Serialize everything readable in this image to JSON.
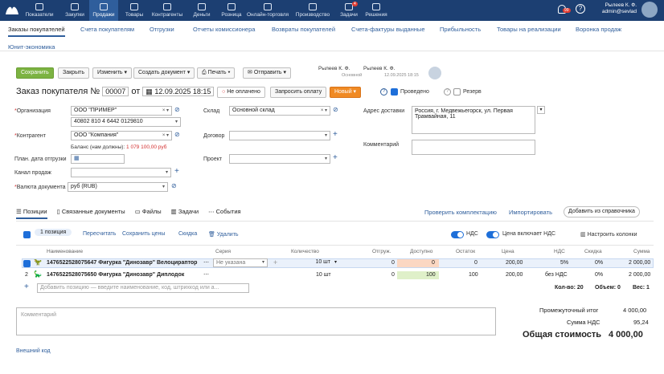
{
  "topnav": {
    "items": [
      {
        "label": "Показатели",
        "icon": "chart-icon"
      },
      {
        "label": "Закупки",
        "icon": "cart-icon"
      },
      {
        "label": "Продажи",
        "icon": "bag-icon"
      },
      {
        "label": "Товары",
        "icon": "box-icon"
      },
      {
        "label": "Контрагенты",
        "icon": "people-icon"
      },
      {
        "label": "Деньги",
        "icon": "money-icon"
      },
      {
        "label": "Розница",
        "icon": "store-icon"
      },
      {
        "label": "Онлайн-торговля",
        "icon": "globe-icon"
      },
      {
        "label": "Производство",
        "icon": "factory-icon"
      },
      {
        "label": "Задачи",
        "icon": "tasks-icon"
      },
      {
        "label": "Решения",
        "icon": "puzzle-icon"
      }
    ],
    "tasks_badge": "4",
    "bell_badge": "99",
    "user_name": "Рылеев К. Ф.",
    "user_account": "admin@sevlad"
  },
  "subtabs": [
    "Заказы покупателей",
    "Счета покупателям",
    "Отгрузки",
    "Отчеты комиссионера",
    "Возвраты покупателей",
    "Счета-фактуры выданные",
    "Прибыльность",
    "Товары на реализации",
    "Воронка продаж",
    "Юнит-экономика"
  ],
  "toolbar": {
    "save": "Сохранить",
    "close": "Закрыть",
    "edit": "Изменить",
    "create": "Создать документ",
    "print": "Печать",
    "send": "Отправить",
    "owner_name": "Рылеев К. Ф.",
    "owner_sub": "Основной",
    "author_name": "Рылеев К. Ф.",
    "author_date": "12.09.2025 18:15"
  },
  "header": {
    "title": "Заказ покупателя №",
    "number": "00007",
    "from": "от",
    "date": "12.09.2025 18:15",
    "payment": "Не оплачено",
    "request": "Запросить оплату",
    "status": "Новый",
    "posted": "Проведено",
    "reserve": "Резерв"
  },
  "form": {
    "org_label": "Организация",
    "org": "ООО \"ПРИМЕР\"",
    "account": "40802 810 4 6442 0129810",
    "contractor_label": "Контрагент",
    "contractor": "ООО \"Компания\"",
    "balance_label": "Баланс (нам должны):",
    "balance": "1 079 100,00 руб",
    "ship_date_label": "План. дата отгрузки",
    "channel_label": "Канал продаж",
    "currency_label": "Валюта документа",
    "currency": "руб (RUB)",
    "warehouse_label": "Склад",
    "warehouse": "Основной склад",
    "contract_label": "Договор",
    "project_label": "Проект",
    "address_label": "Адрес доставки",
    "address": "Россия, г. Медвежьегорск, ул. Первая Трамвайная, 11",
    "comment_label": "Комментарий"
  },
  "doc_tabs": [
    "Позиции",
    "Связанные документы",
    "Файлы",
    "Задачи",
    "События"
  ],
  "doc_actions": {
    "check": "Проверить комплектацию",
    "import": "Импортировать",
    "add": "Добавить из справочника"
  },
  "positions_bar": {
    "count": "1 позиция",
    "recalc": "Пересчитать",
    "save_prices": "Сохранить цены",
    "discount": "Скидка",
    "delete": "Удалить",
    "vat": "НДС",
    "price_incl_vat": "Цена включает НДС",
    "columns": "Настроить колонки"
  },
  "table": {
    "headers": [
      "Наименование",
      "Серия",
      "Количество",
      "Отгруж.",
      "Доступно",
      "Остаток",
      "Цена",
      "НДС",
      "Скидка",
      "Сумма"
    ],
    "rows": [
      {
        "num": "1",
        "name": "1476522528075647 Фигурка \"Динозавр\" Велоцираптор",
        "series": "Не указана",
        "qty": "10 шт",
        "shipped": "0",
        "available": "0",
        "stock": "0",
        "price": "200,00",
        "vat": "5%",
        "discount": "0%",
        "sum": "2 000,00"
      },
      {
        "num": "2",
        "name": "1476522528075650 Фигурка \"Динозавр\" Диплодок",
        "series": "",
        "qty": "10 шт",
        "shipped": "0",
        "available": "100",
        "stock": "100",
        "price": "200,00",
        "vat": "без НДС",
        "discount": "0%",
        "sum": "2 000,00"
      }
    ],
    "add_placeholder": "Добавить позицию — введите наименование, код, штрихкод или а...",
    "qty_total": "Кол-во: 20",
    "volume_total": "Объем: 0",
    "weight_total": "Вес: 1"
  },
  "footer": {
    "comment_placeholder": "Комментарий",
    "subtotal_label": "Промежуточный итог",
    "subtotal": "4 000,00",
    "vat_label": "Сумма НДС",
    "vat": "95,24",
    "total_label": "Общая стоимость",
    "total": "4 000,00",
    "external_code": "Внешний код"
  },
  "colors": {
    "topbar": "#1c3f72",
    "accent": "#2f5e9c",
    "save": "#7cb342",
    "status": "#f08a24"
  }
}
